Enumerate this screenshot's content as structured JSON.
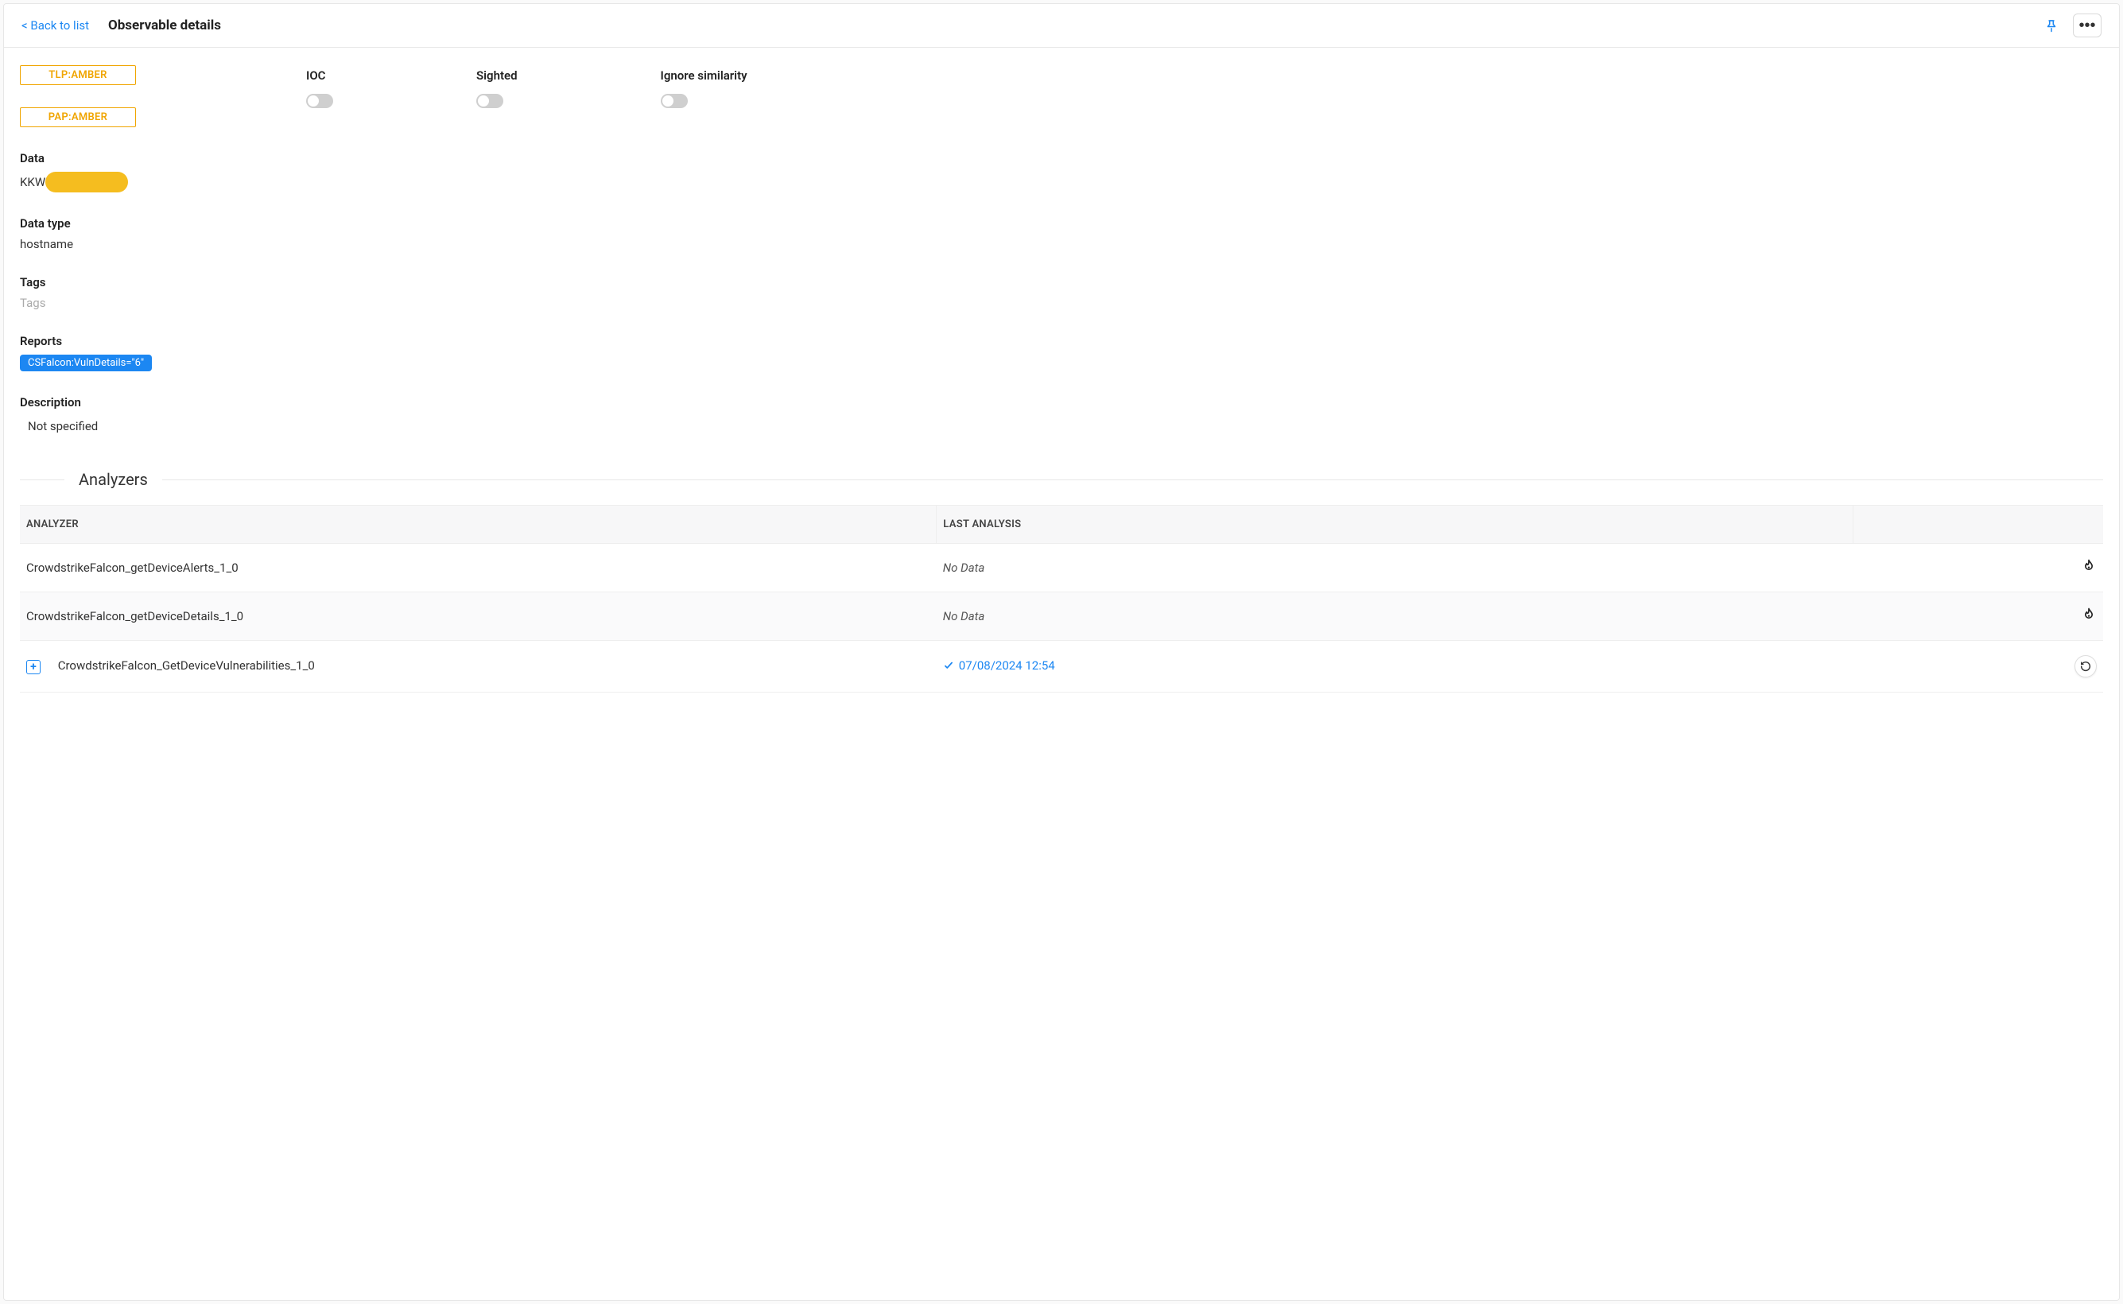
{
  "header": {
    "back_label": "< Back to list",
    "title": "Observable details"
  },
  "chips": {
    "tlp": "TLP:AMBER",
    "pap": "PAP:AMBER"
  },
  "toggles": {
    "ioc": {
      "label": "IOC",
      "value": false
    },
    "sighted": {
      "label": "Sighted",
      "value": false
    },
    "ignore_similarity": {
      "label": "Ignore similarity",
      "value": false
    }
  },
  "fields": {
    "data": {
      "label": "Data",
      "prefix": "KKW",
      "redacted": true
    },
    "data_type": {
      "label": "Data type",
      "value": "hostname"
    },
    "tags": {
      "label": "Tags",
      "placeholder": "Tags"
    },
    "reports": {
      "label": "Reports",
      "items": [
        "CSFalcon:VulnDetails=\"6\""
      ]
    },
    "description": {
      "label": "Description",
      "value": "Not specified"
    }
  },
  "analyzers": {
    "section_title": "Analyzers",
    "columns": {
      "analyzer": "ANALYZER",
      "last": "LAST ANALYSIS"
    },
    "no_data_text": "No Data",
    "rows": [
      {
        "name": "CrowdstrikeFalcon_getDeviceAlerts_1_0",
        "status": "none",
        "last": null,
        "expandable": false,
        "action": "run"
      },
      {
        "name": "CrowdstrikeFalcon_getDeviceDetails_1_0",
        "status": "none",
        "last": null,
        "expandable": false,
        "action": "run"
      },
      {
        "name": "CrowdstrikeFalcon_GetDeviceVulnerabilities_1_0",
        "status": "success",
        "last": "07/08/2024 12:54",
        "expandable": true,
        "action": "rerun"
      }
    ]
  }
}
